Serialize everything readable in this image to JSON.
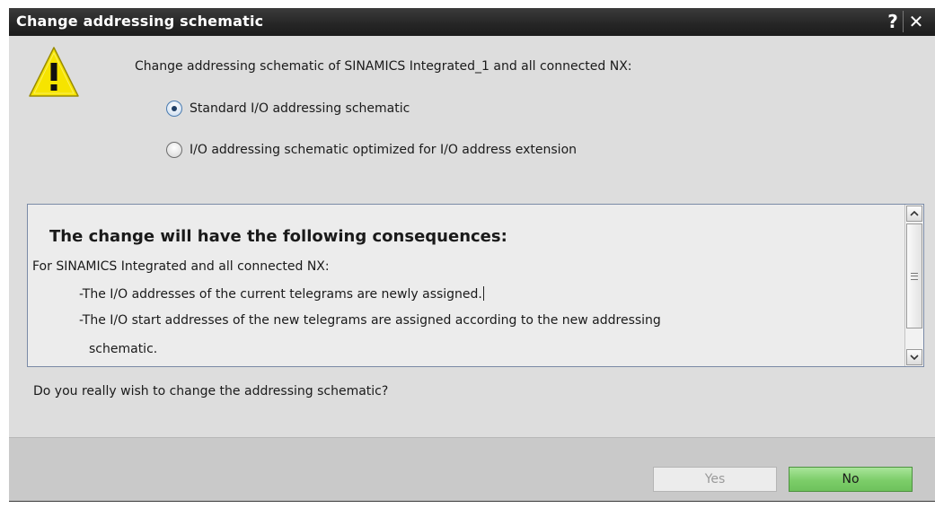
{
  "dialog": {
    "title": "Change addressing schematic",
    "help_label": "?",
    "close_label": "✕"
  },
  "prompt": "Change addressing schematic of SINAMICS Integrated_1 and all connected NX:",
  "options": [
    {
      "label": "Standard I/O addressing schematic",
      "selected": true
    },
    {
      "label": "I/O addressing schematic optimized for I/O address extension",
      "selected": false
    }
  ],
  "consequences": {
    "heading": "The change will have the following consequences:",
    "lines": [
      "For SINAMICS Integrated and all connected NX:",
      "-The I/O addresses of the current telegrams are newly assigned.",
      "-The I/O start addresses of the new telegrams are assigned according to the new addressing",
      "schematic."
    ]
  },
  "question": "Do you really wish to change the addressing schematic?",
  "buttons": {
    "yes": "Yes",
    "no": "No"
  },
  "colors": {
    "titlebar": "#252525",
    "dialog_bg": "#dddddd",
    "warning_yellow": "#f6e400",
    "no_button_green": "#7ccd69",
    "radio_selected": "#1f3f66"
  },
  "icons": {
    "warning": "warning-icon",
    "help": "help-icon",
    "close": "close-icon"
  }
}
